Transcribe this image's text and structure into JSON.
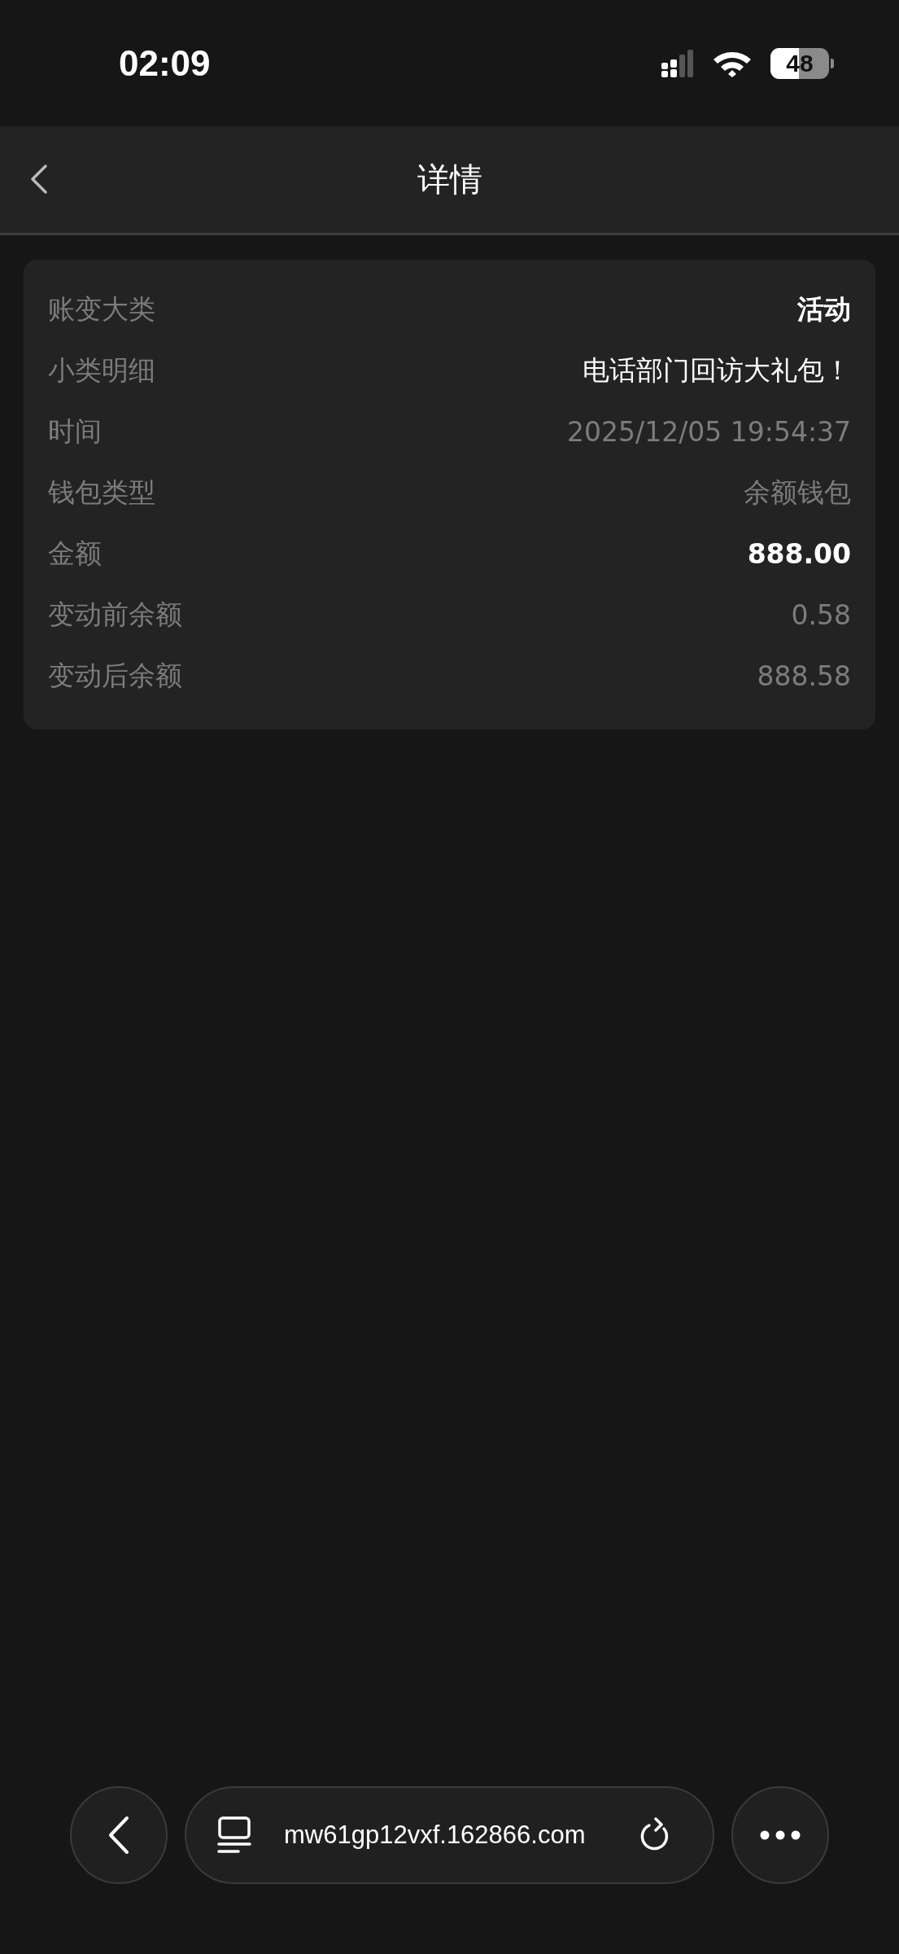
{
  "status_bar": {
    "time": "02:09",
    "battery": "48"
  },
  "header": {
    "title": "详情"
  },
  "details": [
    {
      "label": "账变大类",
      "value": "活动",
      "bold": true,
      "muted": false
    },
    {
      "label": "小类明细",
      "value": "电话部门回访大礼包！",
      "bold": false,
      "muted": false
    },
    {
      "label": "时间",
      "value": "2025/12/05 19:54:37",
      "bold": false,
      "muted": true
    },
    {
      "label": "钱包类型",
      "value": "余额钱包",
      "bold": false,
      "muted": true
    },
    {
      "label": "金额",
      "value": "888.00",
      "bold": true,
      "muted": false
    },
    {
      "label": "变动前余额",
      "value": "0.58",
      "bold": false,
      "muted": true
    },
    {
      "label": "变动后余额",
      "value": "888.58",
      "bold": false,
      "muted": true
    }
  ],
  "browser_bar": {
    "url": "mw61gp12vxf.162866.com"
  }
}
